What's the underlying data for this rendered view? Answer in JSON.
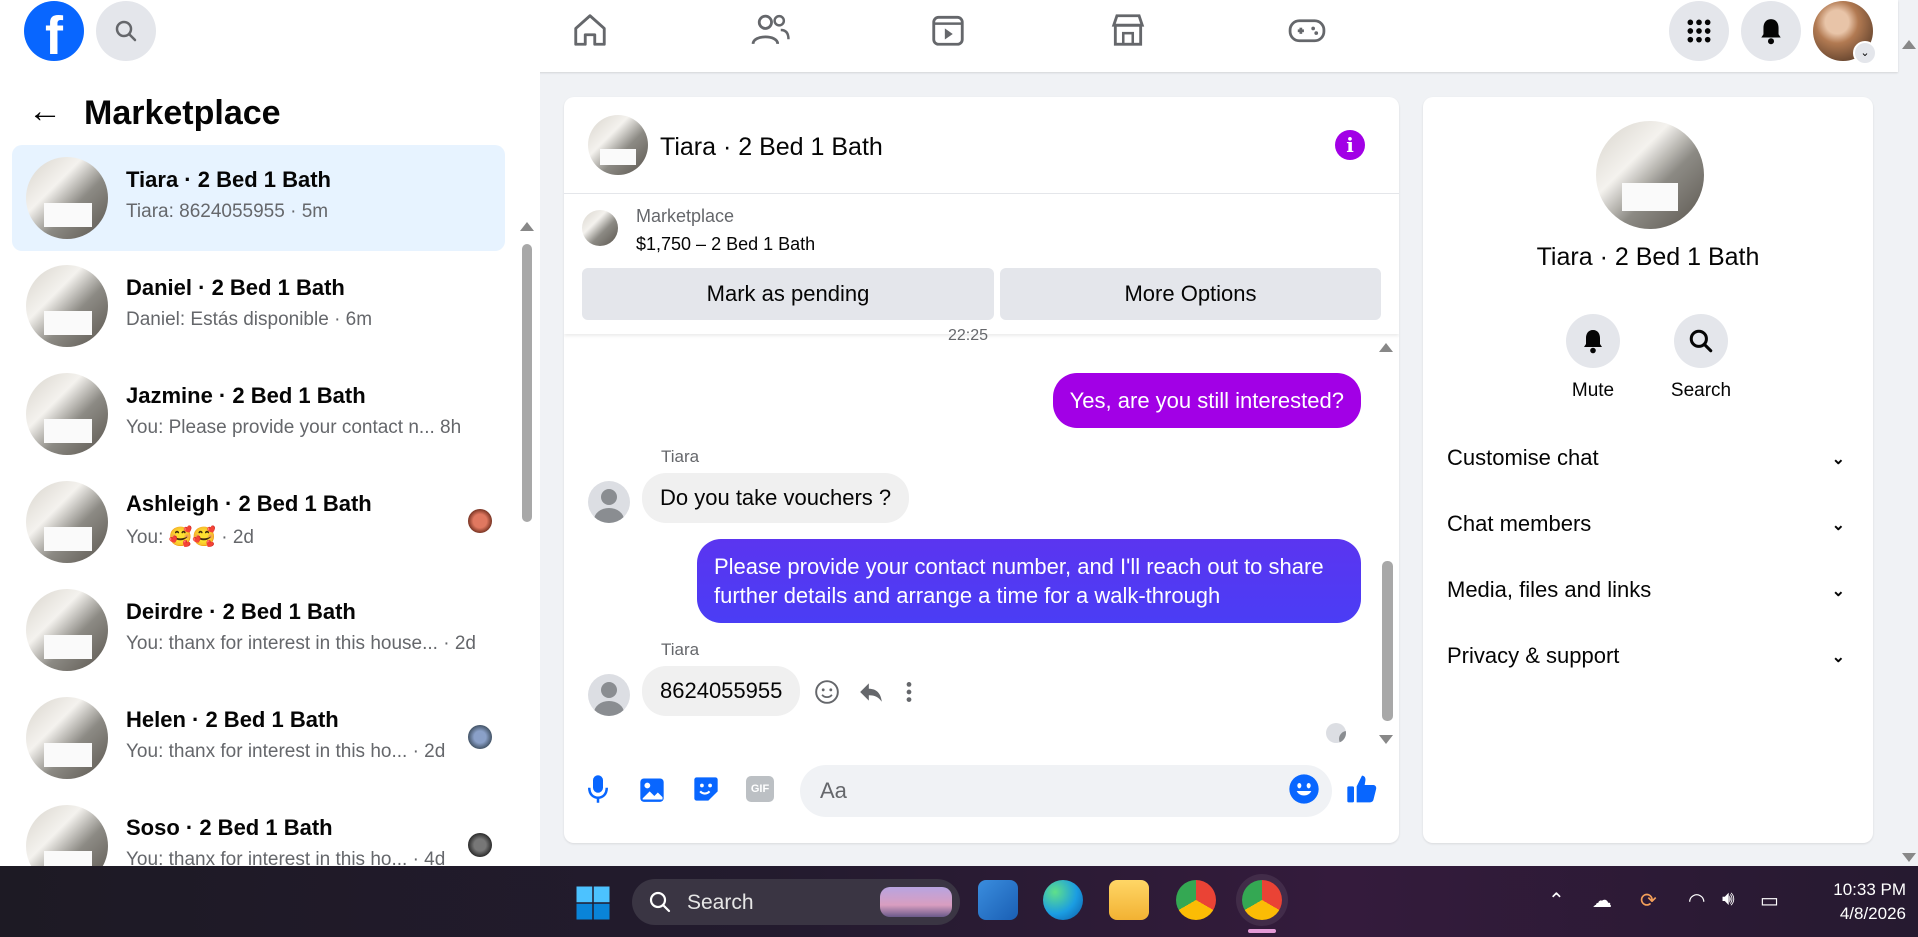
{
  "topbar": {
    "logo": "f",
    "icons": [
      "search-icon",
      "home-icon",
      "friends-icon",
      "video-icon",
      "marketplace-icon",
      "gaming-icon",
      "menu-grid-icon",
      "notifications-icon"
    ]
  },
  "sidebar": {
    "title": "Marketplace",
    "conversations": [
      {
        "name": "Tiara · 2 Bed 1 Bath",
        "preview": "Tiara: 8624055955 · 5m",
        "active": true
      },
      {
        "name": "Daniel · 2 Bed 1 Bath",
        "preview": "Daniel: Estás disponible · 6m"
      },
      {
        "name": "Jazmine · 2 Bed 1 Bath",
        "preview": "You: Please provide your contact n...   8h"
      },
      {
        "name": "Ashleigh · 2 Bed 1 Bath",
        "preview": "You: 🥰🥰 · 2d"
      },
      {
        "name": "Deirdre · 2 Bed 1 Bath",
        "preview": "You: thanx for interest in this house... · 2d"
      },
      {
        "name": "Helen · 2 Bed 1 Bath",
        "preview": "You: thanx for interest in this ho...  · 2d"
      },
      {
        "name": "Soso · 2 Bed 1 Bath",
        "preview": "You: thanx for interest in this ho...  · 4d"
      }
    ]
  },
  "chat": {
    "title": "Tiara · 2 Bed 1 Bath",
    "listing": {
      "label": "Marketplace",
      "price": "$1,750 – 2 Bed 1 Bath",
      "mark_pending": "Mark as pending",
      "more_options": "More Options"
    },
    "timestamp": "22:25",
    "messages": [
      {
        "from": "me",
        "text": "Yes, are you still interested?"
      },
      {
        "from": "Tiara",
        "sender": "Tiara",
        "text": "Do you take vouchers ?"
      },
      {
        "from": "me",
        "text": "Please provide your contact number, and I'll reach out to share further details and arrange a time for a walk-through"
      },
      {
        "from": "Tiara",
        "sender": "Tiara",
        "text": "8624055955"
      }
    ],
    "composer_placeholder": "Aa",
    "gif_label": "GIF"
  },
  "details": {
    "name": "Tiara · 2 Bed 1 Bath",
    "mute": "Mute",
    "search": "Search",
    "sections": [
      "Customise chat",
      "Chat members",
      "Media, files and links",
      "Privacy & support"
    ]
  },
  "taskbar": {
    "search": "Search",
    "time": "10:33 PM",
    "date": "4/8/2026"
  },
  "colors": {
    "brand": "#0866ff",
    "outgoing_purple": "#a200e6",
    "outgoing_blue": "#4a3df5",
    "active_row": "#e7f3ff"
  }
}
